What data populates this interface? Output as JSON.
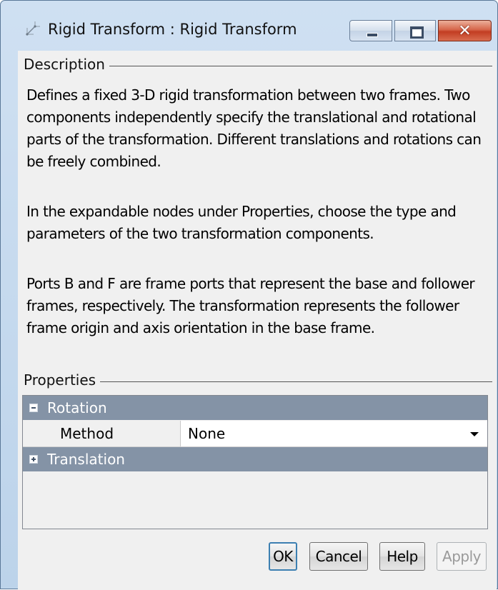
{
  "window": {
    "title": "Rigid Transform : Rigid Transform",
    "icon": "rigid-transform-icon",
    "close_symbol": "✕"
  },
  "description": {
    "label": "Description",
    "paragraphs": [
      "Defines a fixed 3-D rigid transformation between two frames. Two components independently specify the translational and rotational parts of the transformation. Different translations and rotations can be freely combined.",
      "In the expandable nodes under Properties, choose the type and parameters of the two transformation components.",
      "Ports B and F are frame ports that represent the base and follower frames, respectively. The transformation represents the follower frame origin and axis orientation in the base frame."
    ]
  },
  "properties": {
    "label": "Properties",
    "groups": [
      {
        "label": "Rotation",
        "expanded": true,
        "rows": [
          {
            "name": "Method",
            "value": "None"
          }
        ]
      },
      {
        "label": "Translation",
        "expanded": false
      }
    ]
  },
  "buttons": {
    "ok": "OK",
    "cancel": "Cancel",
    "help": "Help",
    "apply": "Apply"
  },
  "colors": {
    "group_header": "#8493a6",
    "frame": "#c4d6ea",
    "close_button": "#c23d22"
  }
}
